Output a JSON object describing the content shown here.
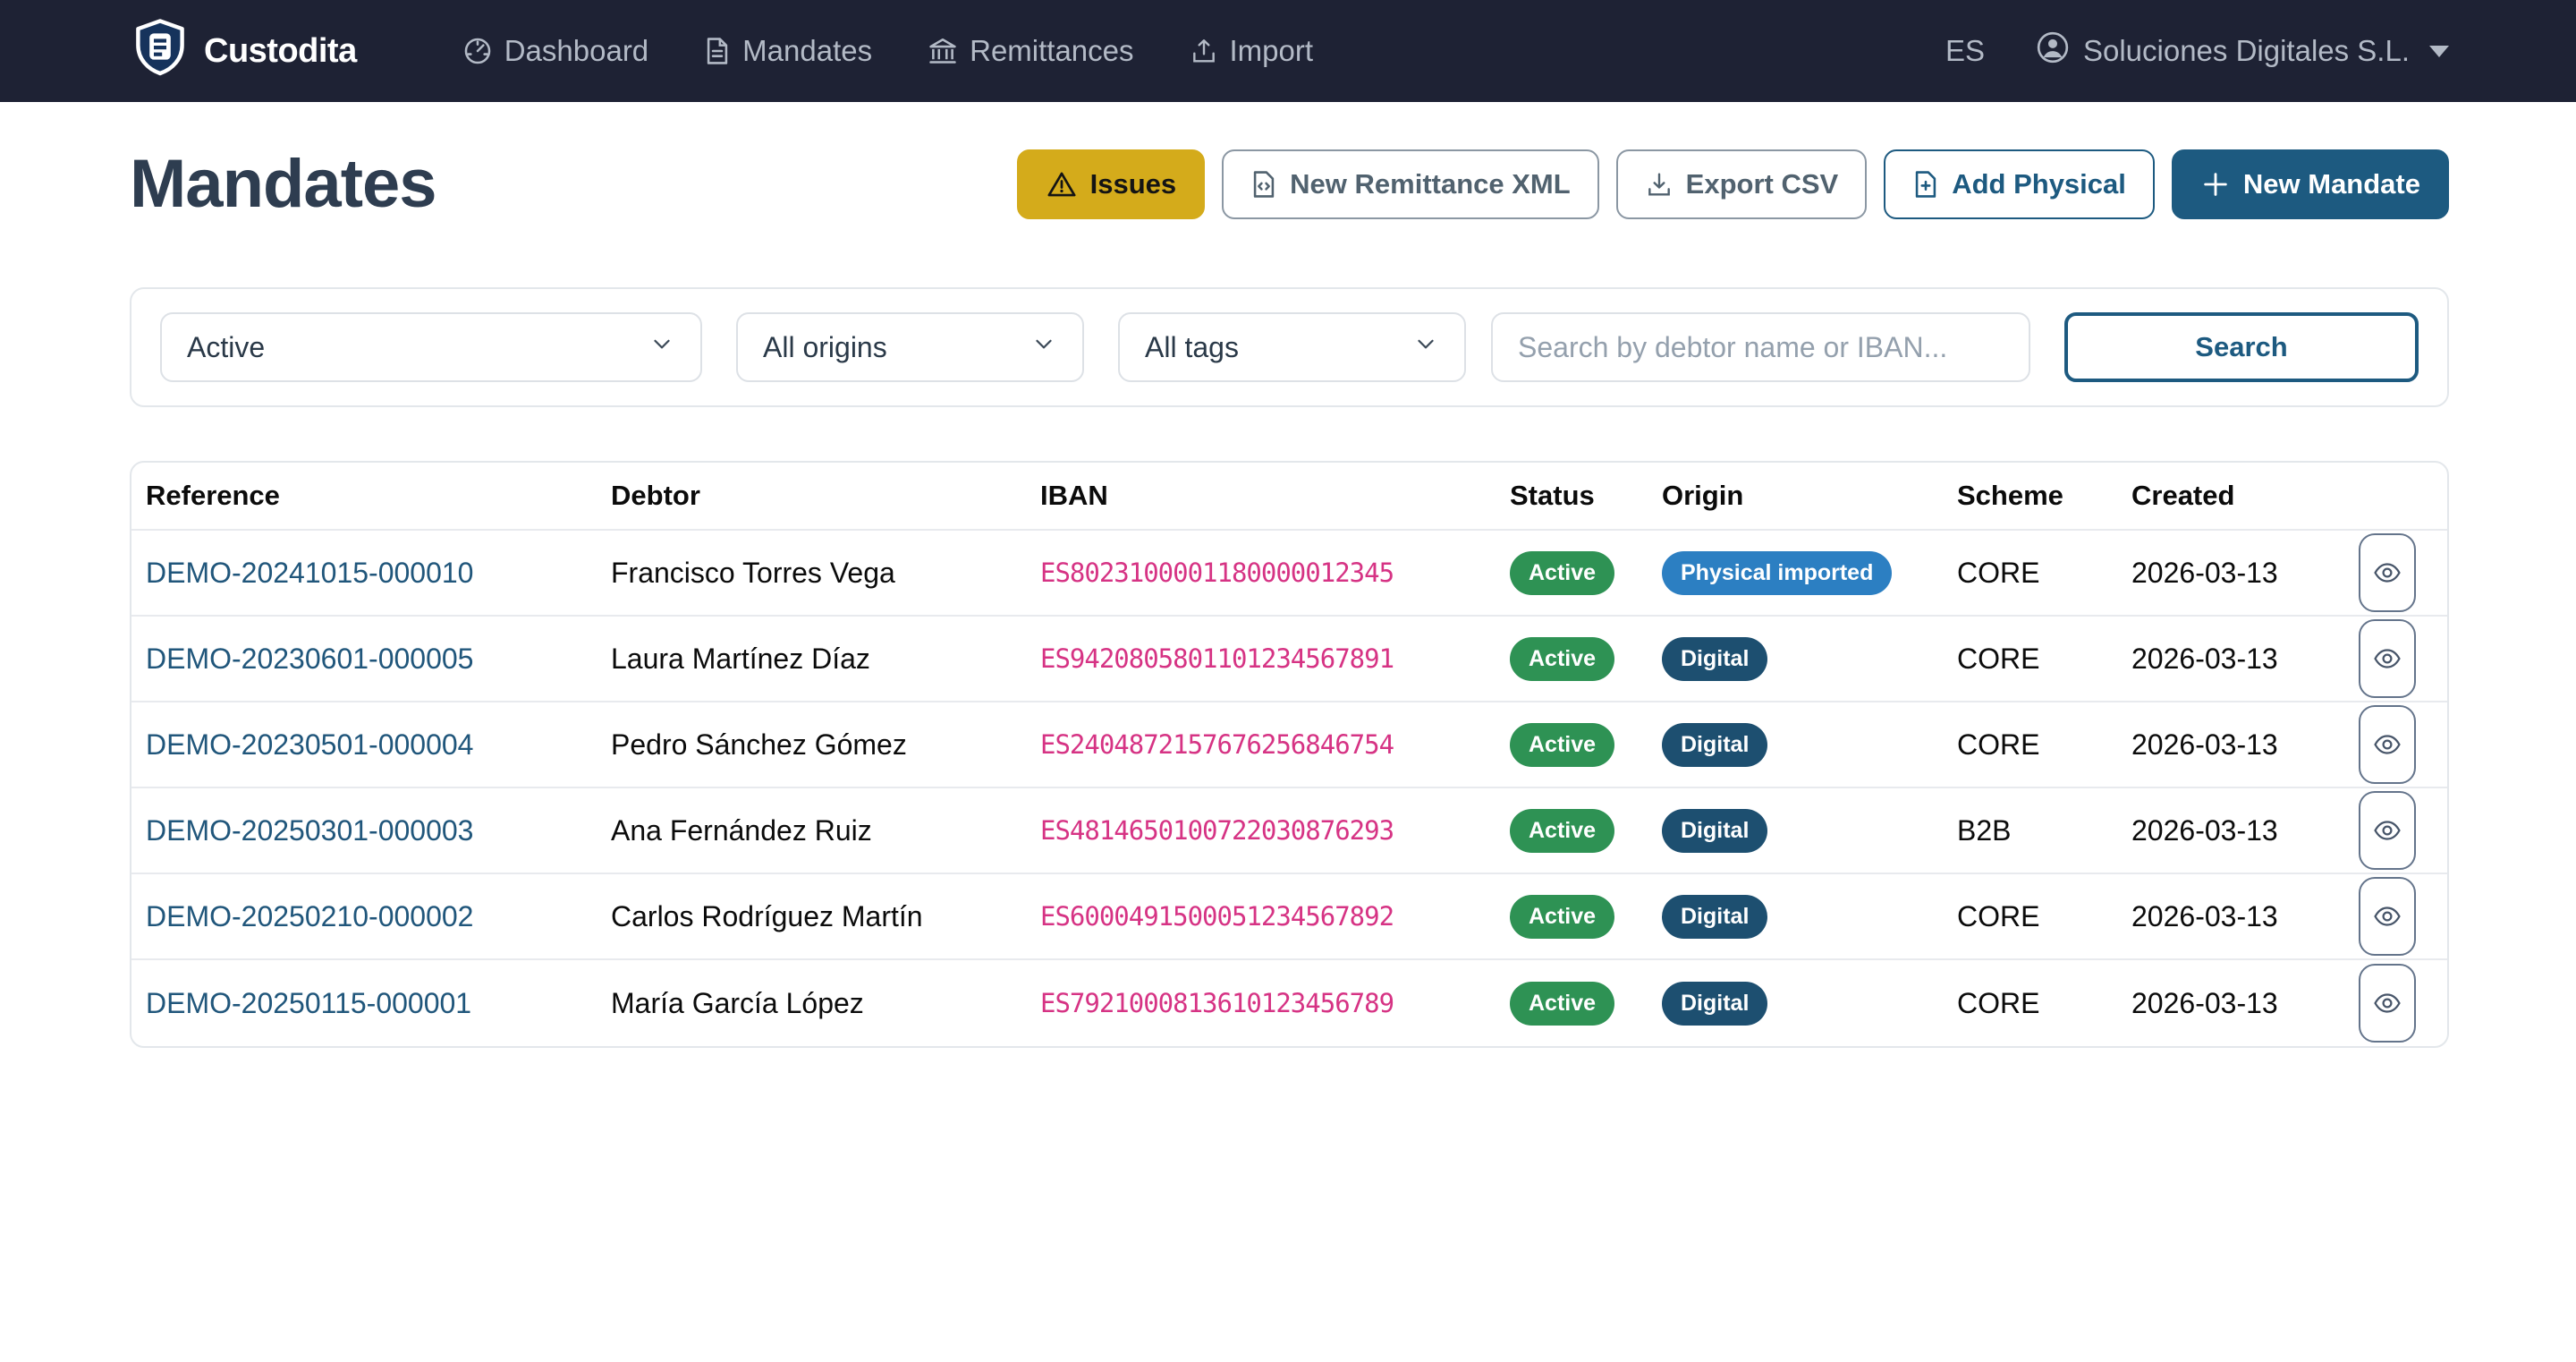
{
  "brand": {
    "name": "Custodita"
  },
  "nav": {
    "items": [
      {
        "label": "Dashboard",
        "icon": "gauge-icon"
      },
      {
        "label": "Mandates",
        "icon": "document-icon"
      },
      {
        "label": "Remittances",
        "icon": "bank-icon"
      },
      {
        "label": "Import",
        "icon": "upload-icon"
      }
    ],
    "language": "ES",
    "account": "Soluciones Digitales S.L."
  },
  "page": {
    "title": "Mandates"
  },
  "toolbar": {
    "issues_label": "Issues",
    "new_remittance_label": "New Remittance XML",
    "export_csv_label": "Export CSV",
    "add_physical_label": "Add Physical",
    "new_mandate_label": "New Mandate"
  },
  "filters": {
    "status_value": "Active",
    "origins_value": "All origins",
    "tags_value": "All tags",
    "search_placeholder": "Search by debtor name or IBAN...",
    "search_button_label": "Search"
  },
  "table": {
    "columns": [
      "Reference",
      "Debtor",
      "IBAN",
      "Status",
      "Origin",
      "Scheme",
      "Created",
      ""
    ],
    "rows": [
      {
        "reference": "DEMO-20241015-000010",
        "debtor": "Francisco Torres Vega",
        "iban": "ES8023100001180000012345",
        "status": "Active",
        "origin": "Physical imported",
        "origin_variant": "physical",
        "scheme": "CORE",
        "created": "2026-03-13"
      },
      {
        "reference": "DEMO-20230601-000005",
        "debtor": "Laura Martínez Díaz",
        "iban": "ES9420805801101234567891",
        "status": "Active",
        "origin": "Digital",
        "origin_variant": "digital",
        "scheme": "CORE",
        "created": "2026-03-13"
      },
      {
        "reference": "DEMO-20230501-000004",
        "debtor": "Pedro Sánchez Gómez",
        "iban": "ES2404872157676256846754",
        "status": "Active",
        "origin": "Digital",
        "origin_variant": "digital",
        "scheme": "CORE",
        "created": "2026-03-13"
      },
      {
        "reference": "DEMO-20250301-000003",
        "debtor": "Ana Fernández Ruiz",
        "iban": "ES4814650100722030876293",
        "status": "Active",
        "origin": "Digital",
        "origin_variant": "digital",
        "scheme": "B2B",
        "created": "2026-03-13"
      },
      {
        "reference": "DEMO-20250210-000002",
        "debtor": "Carlos Rodríguez Martín",
        "iban": "ES6000491500051234567892",
        "status": "Active",
        "origin": "Digital",
        "origin_variant": "digital",
        "scheme": "CORE",
        "created": "2026-03-13"
      },
      {
        "reference": "DEMO-20250115-000001",
        "debtor": "María García López",
        "iban": "ES7921000813610123456789",
        "status": "Active",
        "origin": "Digital",
        "origin_variant": "digital",
        "scheme": "CORE",
        "created": "2026-03-13"
      }
    ]
  },
  "colors": {
    "navbar_bg": "#1e2234",
    "brand_primary": "#1d5a80",
    "issues_yellow": "#d4ab1b",
    "status_active_green": "#2e9254",
    "origin_physical_blue": "#2c7fc2",
    "origin_digital_navy": "#1d4f70",
    "iban_pink": "#d63384",
    "link_blue": "#20567b"
  }
}
